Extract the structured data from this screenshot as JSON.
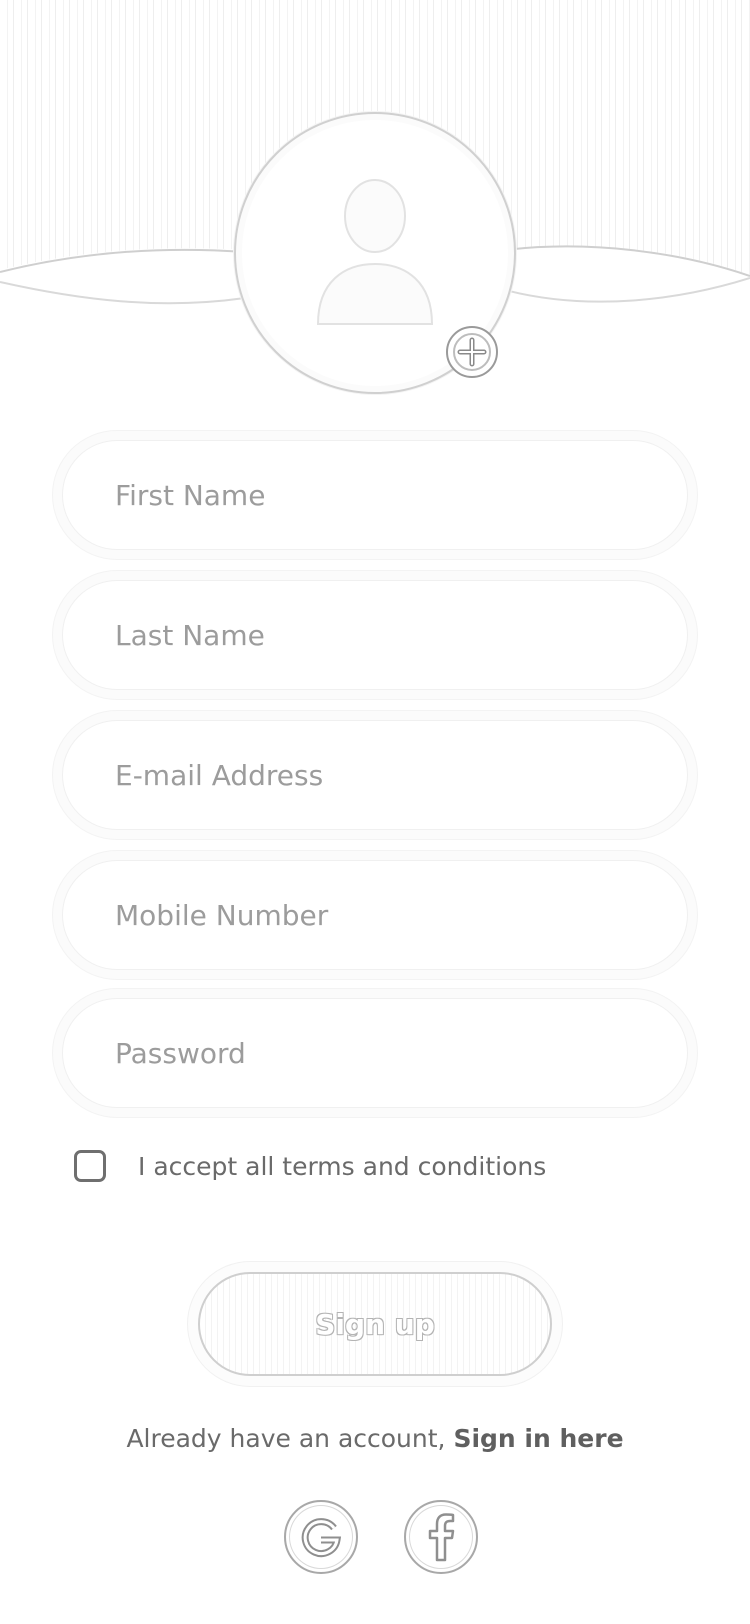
{
  "avatar": {
    "icon": "user-silhouette-icon",
    "add_icon": "plus-circle-icon"
  },
  "form": {
    "first_name": {
      "placeholder": "First Name",
      "value": ""
    },
    "last_name": {
      "placeholder": "Last Name",
      "value": ""
    },
    "email": {
      "placeholder": "E-mail Address",
      "value": ""
    },
    "mobile": {
      "placeholder": "Mobile Number",
      "value": ""
    },
    "password": {
      "placeholder": "Password",
      "value": ""
    }
  },
  "terms": {
    "label": "I accept all terms and conditions",
    "checked": false
  },
  "signup_button": {
    "label": "Sign up"
  },
  "signin": {
    "prefix": "Already have an account, ",
    "link": "Sign in here"
  },
  "social": [
    {
      "name": "google",
      "icon": "google-icon"
    },
    {
      "name": "facebook",
      "icon": "facebook-icon"
    }
  ],
  "colors": {
    "background": "#ffffff",
    "text": "#6a6a6a",
    "placeholder": "#9c9c9c",
    "border": "#d0d0d0"
  }
}
